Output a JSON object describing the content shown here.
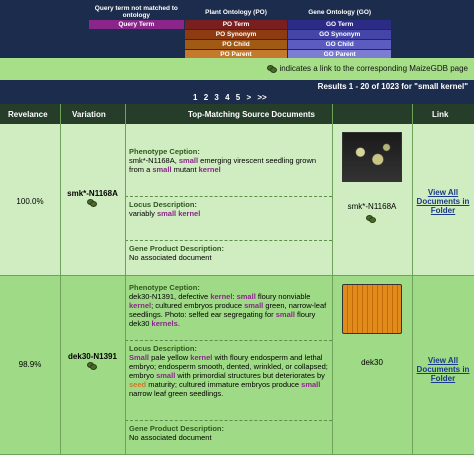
{
  "legend": {
    "col0_header": "Query term not matched to ontology",
    "col0_item": "Query Term",
    "col1_header": "Plant Ontology (PO)",
    "col1_items": [
      "PO Term",
      "PO Synonym",
      "PO Child",
      "PO Parent"
    ],
    "col2_header": "Gene Ontology (GO)",
    "col2_items": [
      "GO Term",
      "GO Synonym",
      "GO Child",
      "GO Parent"
    ],
    "colors": {
      "query": "#8a268a",
      "po": [
        "#7a1f1f",
        "#8e3b12",
        "#a15a14",
        "#c47a2c"
      ],
      "go": [
        "#2c2c86",
        "#4545a8",
        "#5c5cc0",
        "#7c7cd2"
      ]
    }
  },
  "info_text": "indicates a link to the corresponding MaizeGDB page",
  "results_text": "Results 1 - 20 of 1023 for \"small kernel\"",
  "pager": [
    "1",
    "2",
    "3",
    "4",
    "5",
    ">",
    ">>"
  ],
  "columns": [
    "Revelance",
    "Variation",
    "Top-Matching Source Documents",
    "Link"
  ],
  "rows": [
    {
      "relevance": "100.0%",
      "variation": "smk*-N1168A",
      "phenotype_title": "Phenotype Ception:",
      "phenotype_text": [
        "smk*-N1168A, ",
        "small",
        " emerging virescent seedling grown from a ",
        "small",
        " mutant ",
        "kernel"
      ],
      "locus_title": "Locus Description:",
      "locus_text": [
        "variably ",
        "small",
        " ",
        "kernel"
      ],
      "gene_title": "Gene Product Description:",
      "gene_text": "No associated document",
      "thumb_label": "smk*-N1168A",
      "link_text": "View All Documents in Folder"
    },
    {
      "relevance": "98.9%",
      "variation": "dek30-N1391",
      "phenotype_title": "Phenotype Ception:",
      "phenotype_text": [
        "dek30-N1391, defective ",
        "kernel",
        ": ",
        "small",
        " floury nonviable ",
        "kernel",
        "; cultured embryos produce ",
        "small",
        " green, narrow-leaf seedlings. Photo: selfed ear segregating for ",
        "small",
        " floury dek30 ",
        "kernels",
        "."
      ],
      "locus_title": "Locus Description:",
      "locus_text": [
        "Small",
        " pale yellow ",
        "kernel",
        " with floury endosperm and lethal embryo; endosperm smooth, dented, wrinkled, or collapsed; embryo ",
        "small",
        " with primordial structures but deteriorates by ",
        "seed",
        " maturity; cultured immature embryos produce ",
        "small",
        " narrow leaf green seedlings."
      ],
      "gene_title": "Gene Product Description:",
      "gene_text": "No associated document",
      "thumb_label": "dek30",
      "link_text": "View All Documents in Folder"
    }
  ]
}
